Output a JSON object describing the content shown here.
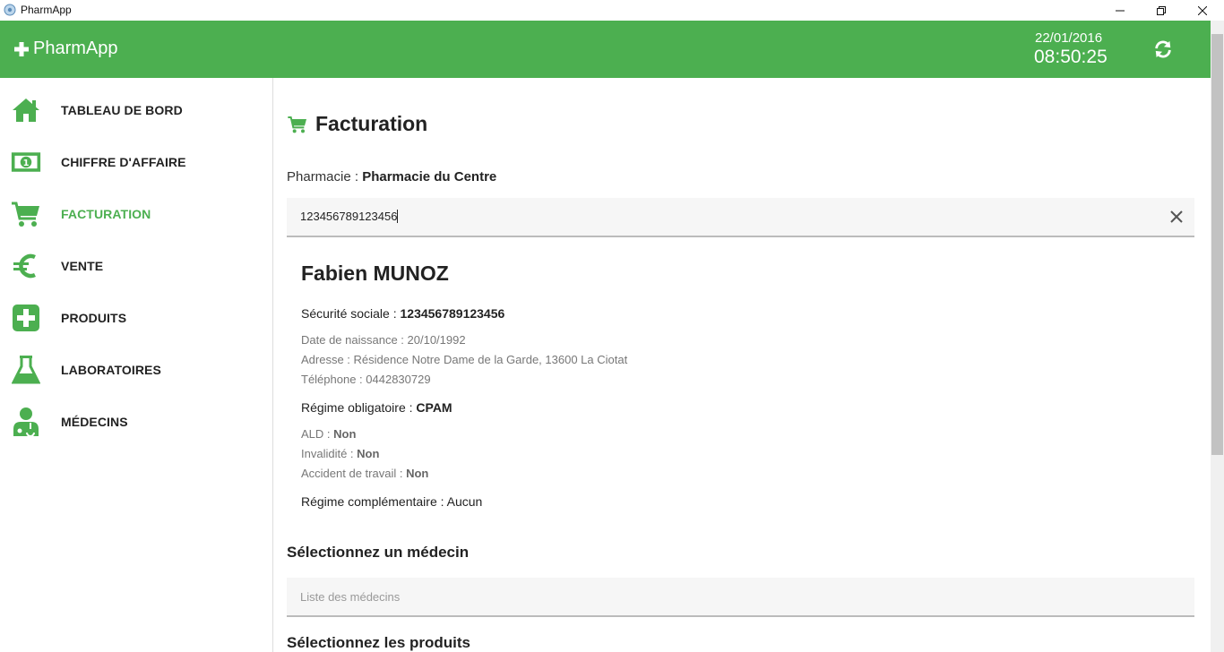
{
  "window": {
    "title": "PharmApp"
  },
  "header": {
    "brand": "PharmApp",
    "date": "22/01/2016",
    "time": "08:50:25",
    "accent_color": "#4caf50"
  },
  "sidebar": {
    "items": [
      {
        "label": "TABLEAU DE BORD",
        "icon": "home-icon",
        "active": false
      },
      {
        "label": "CHIFFRE D'AFFAIRE",
        "icon": "money-icon",
        "active": false
      },
      {
        "label": "FACTURATION",
        "icon": "cart-icon",
        "active": true
      },
      {
        "label": "VENTE",
        "icon": "euro-icon",
        "active": false
      },
      {
        "label": "PRODUITS",
        "icon": "plus-square-icon",
        "active": false
      },
      {
        "label": "LABORATOIRES",
        "icon": "flask-icon",
        "active": false
      },
      {
        "label": "MÉDECINS",
        "icon": "doctor-icon",
        "active": false
      }
    ]
  },
  "main": {
    "title": "Facturation",
    "pharmacy_label": "Pharmacie : ",
    "pharmacy_name": "Pharmacie du Centre",
    "search": {
      "value": "123456789123456"
    },
    "patient": {
      "name": "Fabien MUNOZ",
      "ss_label": "Sécurité sociale : ",
      "ss_value": "123456789123456",
      "birth": "Date de naissance : 20/10/1992",
      "address": "Adresse : Résidence Notre Dame de la Garde, 13600 La Ciotat",
      "phone": "Téléphone : 0442830729",
      "regime_label": "Régime obligatoire : ",
      "regime_value": "CPAM",
      "ald_label": "ALD : ",
      "ald_value": "Non",
      "invalid_label": "Invalidité : ",
      "invalid_value": "Non",
      "accident_label": "Accident de travail : ",
      "accident_value": "Non",
      "complementary": "Régime complémentaire : Aucun"
    },
    "doctor_section_title": "Sélectionnez un médecin",
    "doctor_select_placeholder": "Liste des médecins",
    "products_section_title": "Sélectionnez les produits"
  }
}
